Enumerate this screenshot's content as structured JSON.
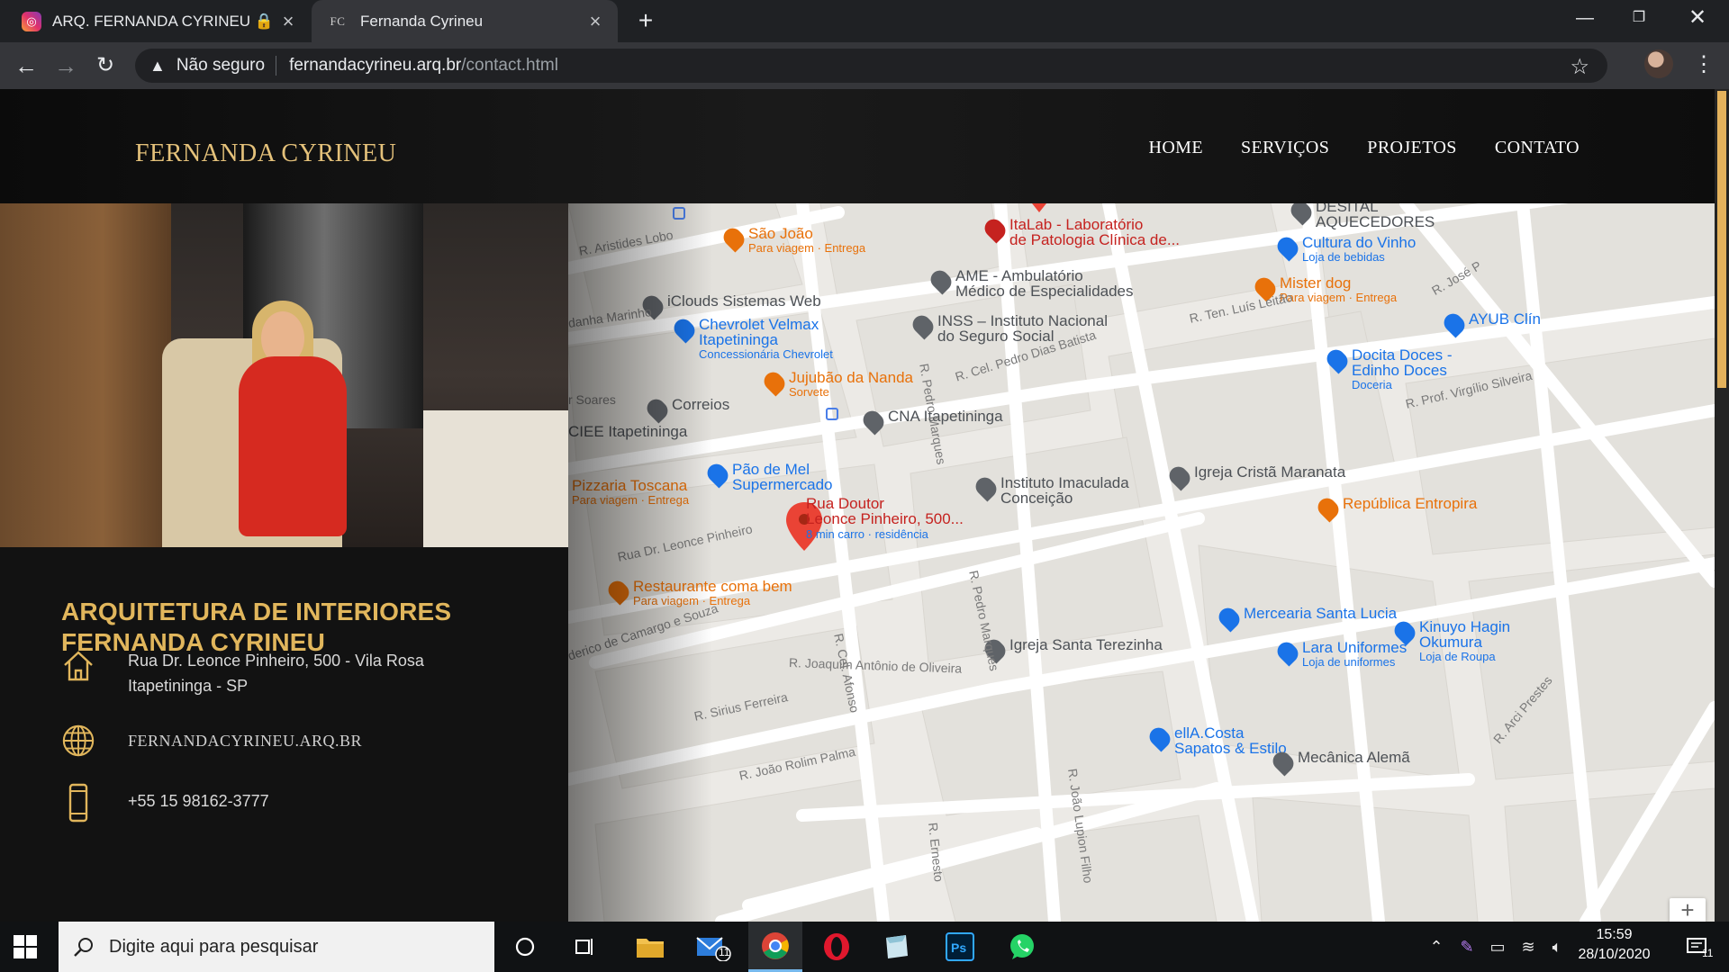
{
  "browser": {
    "tabs": [
      {
        "title": "ARQ. FERNANDA CYRINEU 🔒 (@",
        "favicon": "instagram-icon",
        "active": false
      },
      {
        "title": "Fernanda Cyrineu",
        "favicon_text": "FC",
        "active": true
      }
    ],
    "security_label": "Não seguro",
    "url_host": "fernandacyrineu.arq.br",
    "url_path": "/contact.html"
  },
  "site": {
    "brand": "FERNANDA CYRINEU",
    "nav": [
      "HOME",
      "SERVIÇOS",
      "PROJETOS",
      "CONTATO"
    ],
    "heading": "ARQUITETURA DE INTERIORES FERNANDA CYRINEU",
    "address_line1": "Rua Dr. Leonce Pinheiro, 500 - Vila Rosa",
    "address_line2": "Itapetininga - SP",
    "website": "FERNANDACYRINEU.ARQ.BR",
    "phone": "+55 15 98162-3777",
    "accent_color": "#e1b65c"
  },
  "map": {
    "pin": {
      "title_1": "Rua Doutor",
      "title_2": "Leonce Pinheiro, 500...",
      "subtitle": "8 min carro · residência"
    },
    "places": [
      {
        "name": "São João",
        "sub": "Para viagem · Entrega",
        "kind": "food"
      },
      {
        "name": "ItaLab - Laboratório",
        "name2": "de Patologia Clínica de...",
        "kind": "health"
      },
      {
        "name": "DESITAL",
        "name2": "AQUECEDORES",
        "kind": "place"
      },
      {
        "name": "Cultura do Vinho",
        "sub": "Loja de bebidas",
        "kind": "shop"
      },
      {
        "name": "iClouds Sistemas Web",
        "kind": "place"
      },
      {
        "name": "AME - Ambulatório",
        "name2": "Médico de Especialidades",
        "kind": "gov"
      },
      {
        "name": "Mister dog",
        "sub": "Para viagem · Entrega",
        "kind": "food"
      },
      {
        "name": "AYUB Clín",
        "kind": "shop"
      },
      {
        "name": "Chevrolet Velmax",
        "name2": "Itapetininga",
        "sub": "Concessionária Chevrolet",
        "kind": "shop"
      },
      {
        "name": "INSS – Instituto Nacional",
        "name2": "do Seguro Social",
        "kind": "gov"
      },
      {
        "name": "Docita Doces -",
        "name2": "Edinho Doces",
        "sub": "Doceria",
        "kind": "shop"
      },
      {
        "name": "Jujubão da Nanda",
        "sub": "Sorvete",
        "kind": "food"
      },
      {
        "name": "Correios",
        "kind": "place"
      },
      {
        "name": "CNA Itapetininga",
        "kind": "place"
      },
      {
        "name": "CIEE Itapetininga",
        "kind": "place"
      },
      {
        "name": "Pão de Mel",
        "name2": "Supermercado",
        "kind": "shop"
      },
      {
        "name": "Igreja Cristã Maranata",
        "kind": "church"
      },
      {
        "name": "Pizzaria Toscana",
        "sub": "Para viagem · Entrega",
        "kind": "food"
      },
      {
        "name": "Instituto Imaculada",
        "name2": "Conceição",
        "kind": "place"
      },
      {
        "name": "República Entropira",
        "kind": "food"
      },
      {
        "name": "Restaurante coma bem",
        "sub": "Para viagem · Entrega",
        "kind": "food"
      },
      {
        "name": "Mercearia Santa Lucia",
        "kind": "shop"
      },
      {
        "name": "Igreja Santa Terezinha",
        "kind": "church"
      },
      {
        "name": "Lara Uniformes",
        "sub": "Loja de uniformes",
        "kind": "shop"
      },
      {
        "name": "Kinuyo Hagin",
        "name2": "Okumura",
        "sub": "Loja de Roupa",
        "kind": "shop"
      },
      {
        "name": "ellA.Costa",
        "name2": "Sapatos & Estilo",
        "kind": "shop"
      },
      {
        "name": "Mecânica Alemã",
        "kind": "place"
      }
    ],
    "streets": [
      "R. Aristides Lobo",
      "R. Pedro Marques",
      "R. Cel. Pedro Dias Batista",
      "R. Ten. Luís Leitão",
      "R. José P",
      "danha Marinho",
      "r Soares",
      "R. Prof. Virgílio Silveira",
      "Rua Dr. Leonce Pinheiro",
      "R. Cel. Afonso",
      "R. Pedro Marques",
      "derico de Camargo e Souza",
      "R. Joaquim Antônio de Oliveira",
      "R. Sirius Ferreira",
      "R. João Lupion Filho",
      "R. Ernesto",
      "R. João Rolim Palma",
      "R. Arci Prestes"
    ]
  },
  "taskbar": {
    "search_placeholder": "Digite aqui para pesquisar",
    "time": "15:59",
    "date": "28/10/2020",
    "mail_badge": "11",
    "notif_badge": "11"
  }
}
